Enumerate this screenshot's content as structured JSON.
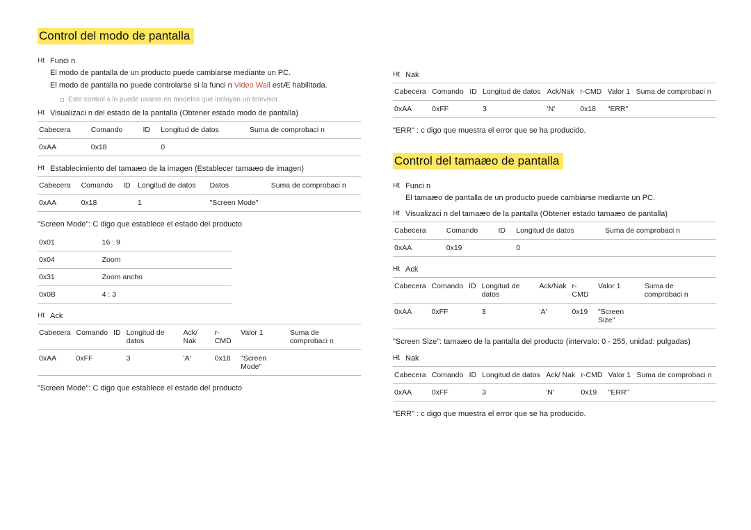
{
  "left": {
    "title": "Control del modo de pantalla",
    "func_label": "Funci n",
    "func_p1": "El modo de pantalla de un producto puede cambiarse mediante un PC.",
    "func_p2_a": "El modo de pantalla no puede controlarse si la funci n ",
    "func_p2_vw": "Video Wall",
    "func_p2_b": " estÆ habilitada.",
    "note": "Este control s lo puede usarse en modelos que incluyan un televisor.",
    "view_label": "Visualizaci n del estado de la pantalla (Obtener estado modo de pantalla)",
    "t1": {
      "h": [
        "Cabecera",
        "Comando",
        "ID",
        "Longitud de datos",
        "Suma de comprobaci n"
      ],
      "r": [
        "0xAA",
        "0x18",
        "",
        "0",
        ""
      ]
    },
    "set_label": "Establecimiento del tamaæo de la imagen (Establecer tamaæo de imagen)",
    "t2": {
      "h": [
        "Cabecera",
        "Comando",
        "ID",
        "Longitud de datos",
        "Datos",
        "Suma de comprobaci n"
      ],
      "r": [
        "0xAA",
        "0x18",
        "",
        "1",
        "\"Screen Mode\"",
        ""
      ]
    },
    "sm_desc": "\"Screen Mode\": C digo que establece el estado del producto",
    "codes": [
      [
        "0x01",
        "16 : 9"
      ],
      [
        "0x04",
        "Zoom"
      ],
      [
        "0x31",
        "Zoom ancho"
      ],
      [
        "0x0B",
        "4 : 3"
      ]
    ],
    "ack_label": "Ack",
    "t3": {
      "h": [
        "Cabecera",
        "Comando",
        "ID",
        "Longitud de datos",
        "Ack/ Nak",
        "r-CMD",
        "Valor 1",
        "Suma de comprobaci n"
      ],
      "r": [
        "0xAA",
        "0xFF",
        "",
        "3",
        "'A'",
        "0x18",
        "\"Screen Mode\"",
        ""
      ]
    },
    "sm_desc2": "\"Screen Mode\": C digo que establece el estado del producto"
  },
  "right": {
    "nak_label": "Nak",
    "t4": {
      "h": [
        "Cabecera",
        "Comando",
        "ID",
        "Longitud de datos",
        "Ack/Nak",
        "r-CMD",
        "Valor 1",
        "Suma de comprobaci n"
      ],
      "r": [
        "0xAA",
        "0xFF",
        "",
        "3",
        "'N'",
        "0x18",
        "\"ERR\"",
        ""
      ]
    },
    "err_desc": "\"ERR\" : c digo que muestra el error que se ha producido.",
    "title2": "Control del tamaæo de pantalla",
    "func_label": "Funci n",
    "func_p1": "El tamaæo de pantalla de un producto puede cambiarse mediante un PC.",
    "view_label": "Visualizaci n del tamaæo de la pantalla (Obtener estado tamaæo de pantalla)",
    "t5": {
      "h": [
        "Cabecera",
        "Comando",
        "ID",
        "Longitud de datos",
        "Suma de comprobaci n"
      ],
      "r": [
        "0xAA",
        "0x19",
        "",
        "0",
        ""
      ]
    },
    "ack_label": "Ack",
    "t6": {
      "h": [
        "Cabecera",
        "Comando",
        "ID",
        "Longitud de datos",
        "Ack/Nak",
        "r-CMD",
        "Valor 1",
        "Suma de comprobaci n"
      ],
      "r": [
        "0xAA",
        "0xFF",
        "",
        "3",
        "'A'",
        "0x19",
        "\"Screen Size\"",
        ""
      ]
    },
    "ss_desc": "\"Screen Size\": tamaæo de la pantalla del producto (intervalo: 0 - 255, unidad: pulgadas)",
    "nak_label2": "Nak",
    "t7": {
      "h": [
        "Cabecera",
        "Comando",
        "ID",
        "Longitud de datos",
        "Ack/ Nak",
        "r-CMD",
        "Valor 1",
        "Suma de comprobaci n"
      ],
      "r": [
        "0xAA",
        "0xFF",
        "",
        "3",
        "'N'",
        "0x19",
        "\"ERR\"",
        ""
      ]
    },
    "err_desc2": "\"ERR\" : c digo que muestra el error que se ha producido."
  }
}
